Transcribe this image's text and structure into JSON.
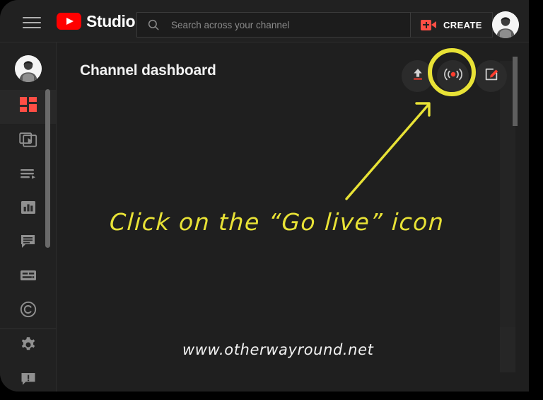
{
  "app": {
    "name": "YouTube Studio",
    "brand_text": "Studio",
    "accent_red": "#ff0000",
    "create_red": "#ff4e45",
    "bg_dark": "#1f1f1f",
    "bar_dark": "#212121",
    "highlight_yellow": "#e8e236"
  },
  "topbar": {
    "menu_icon": "hamburger-icon",
    "logo_icon": "youtube-logo-icon",
    "brand_text": "Studio",
    "search": {
      "icon": "search-icon",
      "placeholder": "Search across your channel",
      "value": ""
    },
    "create": {
      "icon": "video-camera-plus-icon",
      "label": "CREATE"
    },
    "avatar": "account-avatar"
  },
  "sidebar": {
    "avatar": "channel-avatar",
    "items": [
      {
        "id": "dashboard",
        "icon": "dashboard-grid-icon",
        "active": true
      },
      {
        "id": "content",
        "icon": "video-content-icon",
        "active": false
      },
      {
        "id": "playlists",
        "icon": "playlist-icon",
        "active": false
      },
      {
        "id": "analytics",
        "icon": "analytics-bar-chart-icon",
        "active": false
      },
      {
        "id": "comments",
        "icon": "comment-bubble-icon",
        "active": false
      },
      {
        "id": "subtitles",
        "icon": "subtitles-icon",
        "active": false
      },
      {
        "id": "copyright",
        "icon": "copyright-icon",
        "active": false
      },
      {
        "id": "settings",
        "icon": "gear-icon",
        "active": false
      },
      {
        "id": "feedback",
        "icon": "send-feedback-icon",
        "active": false
      }
    ],
    "scrollbar": "sidebar-scrollbar"
  },
  "main": {
    "title": "Channel dashboard",
    "actions": [
      {
        "id": "upload",
        "icon": "upload-arrow-icon",
        "highlighted": false
      },
      {
        "id": "golive",
        "icon": "go-live-broadcast-icon",
        "highlighted": true
      },
      {
        "id": "post",
        "icon": "create-post-pencil-icon",
        "highlighted": false
      }
    ],
    "scrollbar": "main-scrollbar"
  },
  "annotation": {
    "instruction": "Click on the “Go live” icon",
    "arrow": "pointer-arrow",
    "highlight_circle": "go-live-highlight-circle",
    "color": "#e8e236"
  },
  "watermark": {
    "text": "www.otherwayround.net"
  }
}
